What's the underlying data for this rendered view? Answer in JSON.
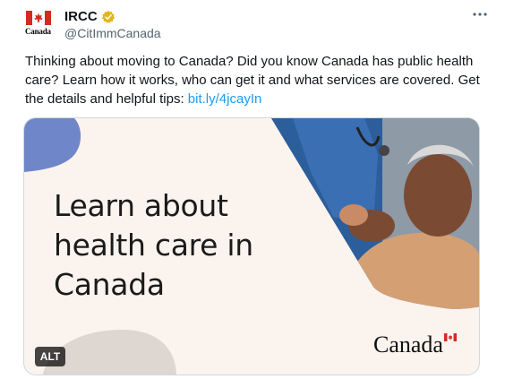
{
  "tweet": {
    "author": {
      "display_name": "IRCC",
      "handle": "@CitImmCanada",
      "avatar_wordmark": "Canada",
      "verified_badge_color": "#e2b719"
    },
    "more_icon": "more-horizontal-icon",
    "text": "Thinking about moving to Canada? Did you know Canada has public health care? Learn how it works, who can get it and what services are covered. Get the details and helpful tips: ",
    "link": "bit.ly/4jcayIn",
    "link_color": "#1d9bf0"
  },
  "media": {
    "headline": "Learn about health care in Canada",
    "wordmark": "Canada",
    "alt_badge": "ALT",
    "background_color": "#fbf3ee",
    "accent_blob_color": "#6f86c8",
    "shadow_blob_color": "#ddd6d1"
  }
}
